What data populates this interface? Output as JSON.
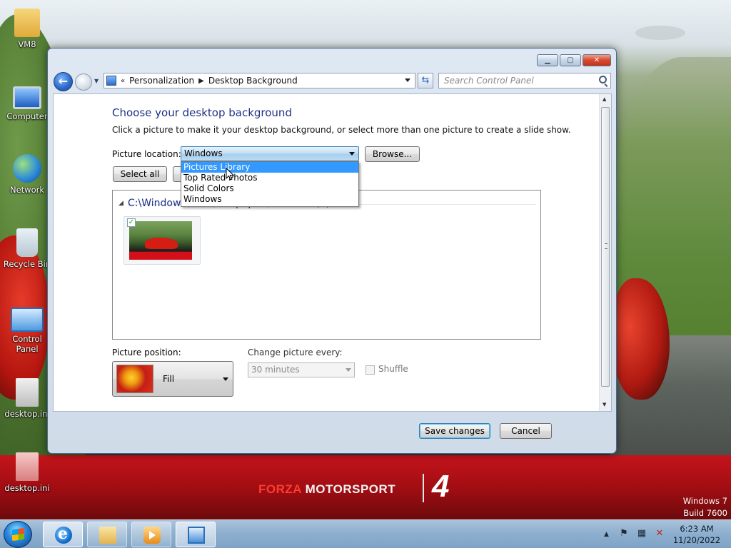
{
  "desktop": {
    "icons": [
      {
        "label": "VM8",
        "icon": "folder-user-icon"
      },
      {
        "label": "Computer",
        "icon": "computer-icon"
      },
      {
        "label": "Network",
        "icon": "network-icon"
      },
      {
        "label": "Recycle Bin",
        "icon": "recycle-bin-icon"
      },
      {
        "label": "Control Panel",
        "icon": "control-panel-icon"
      },
      {
        "label": "desktop.ini",
        "icon": "settings-file-icon"
      },
      {
        "label": "desktop.ini",
        "icon": "settings-file-icon"
      }
    ],
    "wallpaper_brand_left": "FORZA",
    "wallpaper_brand_right": " MOTORSPORT",
    "wallpaper_logo": "4",
    "os_name": "Windows 7",
    "os_build": "Build 7600"
  },
  "window": {
    "caption_buttons": {
      "minimize": "▁",
      "maximize": "▢",
      "close": "✕"
    },
    "breadcrumb": [
      "Personalization",
      "Desktop Background"
    ],
    "search_placeholder": "Search Control Panel",
    "title": "Choose your desktop background",
    "subtitle": "Click a picture to make it your desktop background, or select more than one picture to create a slide show.",
    "picture_location_label": "Picture location:",
    "picture_location_value": "Windows",
    "browse_label": "Browse...",
    "select_all_label": "Select all",
    "dropdown_options": [
      "Pictures Library",
      "Top Rated Photos",
      "Solid Colors",
      "Windows"
    ],
    "dropdown_highlighted": "Pictures Library",
    "group_label": "C:\\Windows\\Web\\Wallpaper\\Windows (1)",
    "picture_position_label": "Picture position:",
    "picture_position_value": "Fill",
    "change_picture_label": "Change picture every:",
    "change_picture_value": "30 minutes",
    "shuffle_label": "Shuffle",
    "save_label": "Save changes",
    "cancel_label": "Cancel"
  },
  "taskbar": {
    "pinned": [
      "internet-explorer-icon",
      "windows-explorer-icon",
      "media-player-icon",
      "control-panel-icon"
    ],
    "time": "6:23 AM",
    "date": "11/20/2022"
  },
  "colors": {
    "title_blue": "#1e3287",
    "selection": "#3399ff",
    "banner_red": "#c4141b"
  }
}
